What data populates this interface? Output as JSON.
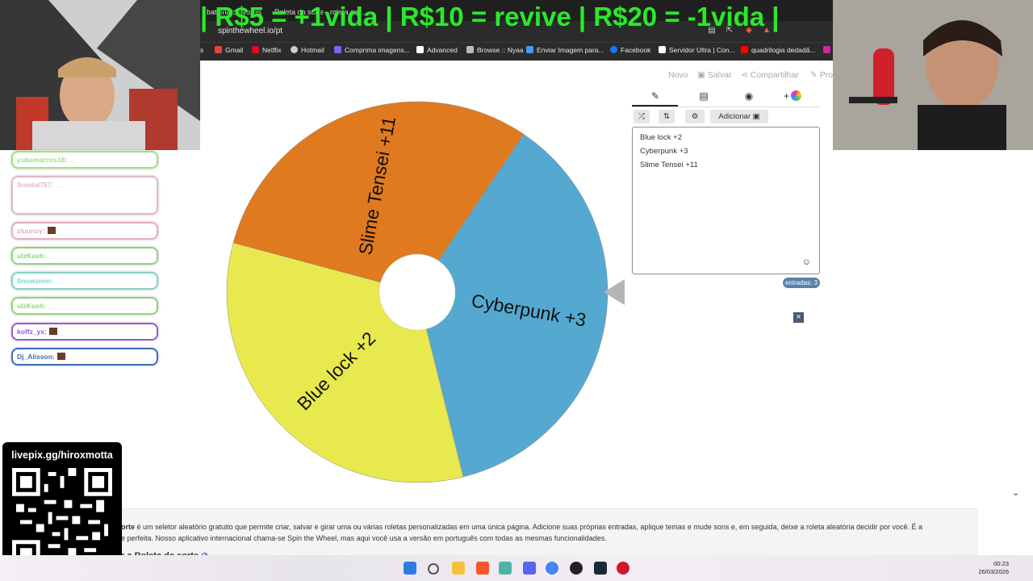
{
  "banner": {
    "text": "| R$5 = +1vida | R$10 = revive | R$20 = -1vida |"
  },
  "browser": {
    "tabs": [
      {
        "label": "batalha de vozes"
      },
      {
        "label": "Roleta da sorte - roleta ger..."
      }
    ],
    "url": "spinthewheel.io/pt",
    "bookmarks": [
      {
        "label": "Gmail",
        "color": "#ea4335"
      },
      {
        "label": "Netflix",
        "color": "#e50914"
      },
      {
        "label": "Hotmail",
        "color": "#cccccc"
      },
      {
        "label": "Comprima imagens...",
        "color": "#7b61ff"
      },
      {
        "label": "Advanced",
        "color": "#ffffff"
      },
      {
        "label": "Browse :: Nyaa",
        "color": "#bbbbbb"
      },
      {
        "label": "Enviar Imagem para...",
        "color": "#3aa0ff"
      },
      {
        "label": "Facebook",
        "color": "#1877f2"
      },
      {
        "label": "Servidor Ultra | Con...",
        "color": "#ffffff"
      },
      {
        "label": "quadrilogia dedadã...",
        "color": "#ff0000"
      }
    ]
  },
  "toolbar": {
    "new_label": "Novo",
    "save_label": "Salvar",
    "share_label": "Compartilhar",
    "more_label": "Pro"
  },
  "wheel": {
    "segments": [
      {
        "label": "Slime Tensei +11",
        "color": "#e07a1f"
      },
      {
        "label": "Cyberpunk +3",
        "color": "#55a9d1"
      },
      {
        "label": "Blue lock +2",
        "color": "#e8e84f"
      }
    ],
    "pointer_color": "#b5b5b5"
  },
  "editor": {
    "add_label": "Adicionar",
    "entries": [
      "Blue lock +2",
      "Cyberpunk +3",
      "Slime Tensei +11"
    ],
    "count_label": "entradas: 3",
    "close_label": "×"
  },
  "chat": [
    {
      "user": "yukumarcos18:",
      "msg": "...",
      "color": "#9fe07a"
    },
    {
      "user": "Snodal757:",
      "msg": "...",
      "color": "#e0b9c9"
    },
    {
      "user": "ziuunuy:",
      "msg": "",
      "color": "#e3b0b8"
    },
    {
      "user": "ulzKush:",
      "msg": "...",
      "color": "#8fd47a"
    },
    {
      "user": "Snowznnn:",
      "msg": "...",
      "color": "#7fd4c6"
    },
    {
      "user": "ulzKush:",
      "msg": "...",
      "color": "#8fd47a"
    },
    {
      "user": "koffz_yx:",
      "msg": "",
      "color": "#9b59d0"
    },
    {
      "user": "Dj_Alisson:",
      "msg": "",
      "color": "#3a6fb5"
    }
  ],
  "bottom": {
    "text_bold": "orte",
    "text_line1": " é um seletor aleatório gratuito que permite criar, salvar e girar uma ou várias roletas personalizadas em uma única página. Adicione suas próprias entradas, aplique temas e mude sons e, em seguida, deixe a roleta aleatória decidir por você. É a",
    "text_line2": "e perfeita. Nosso aplicativo internacional chama-se Spin the Wheel, mas aqui você usa a versão em português com todas as mesmas funcionalidades.",
    "heading": "r a Roleta da sorte"
  },
  "qr": {
    "label": "livepix.gg/hiroxmotta"
  },
  "taskbar": {
    "time": "00:23",
    "date": "26/03/2026"
  }
}
